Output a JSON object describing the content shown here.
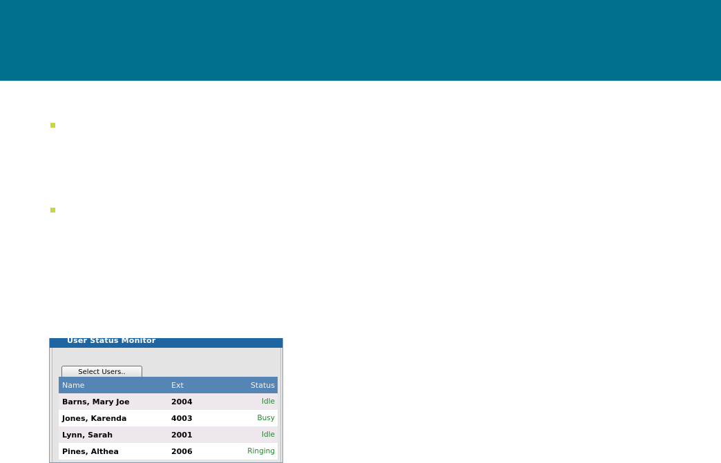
{
  "widget": {
    "title": "User Status Monitor",
    "select_button_label": "Select Users.."
  },
  "table": {
    "columns": [
      "Name",
      "Ext",
      "Status"
    ],
    "rows": [
      {
        "name": "Barns, Mary Joe",
        "ext": "2004",
        "status": "Idle"
      },
      {
        "name": "Jones, Karenda",
        "ext": "4003",
        "status": "Busy"
      },
      {
        "name": "Lynn, Sarah",
        "ext": "2001",
        "status": "Idle"
      },
      {
        "name": "Pines, Althea",
        "ext": "2006",
        "status": "Ringing"
      }
    ]
  },
  "colors": {
    "header_band": "#00708e",
    "bullet": "#c9d63c",
    "widget_titlebar": "#1e65a2",
    "table_header": "#5585b5",
    "status_text": "#1f8a2c"
  }
}
